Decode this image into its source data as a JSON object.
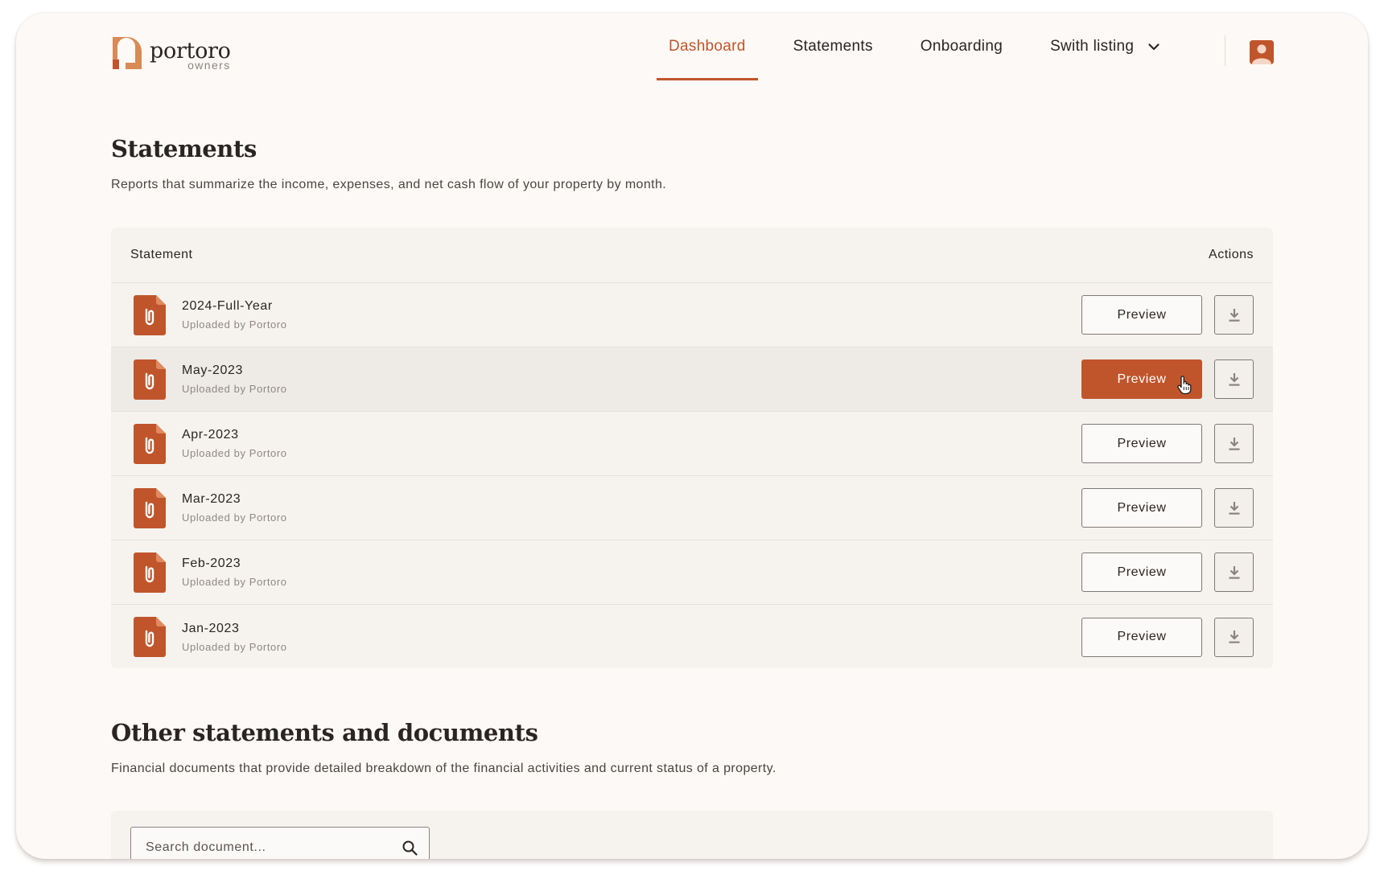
{
  "brand": {
    "name": "portoro",
    "sub": "owners",
    "accent": "#c0552b"
  },
  "nav": {
    "items": [
      {
        "label": "Dashboard",
        "active": true
      },
      {
        "label": "Statements",
        "active": false
      },
      {
        "label": "Onboarding",
        "active": false
      },
      {
        "label": "Swith listing",
        "active": false
      }
    ],
    "dropdown_icon": "chevron-down-icon",
    "avatar_icon": "user-avatar-icon"
  },
  "statements": {
    "title": "Statements",
    "description": "Reports that summarize the income, expenses, and net cash flow of your property by month.",
    "col_statement": "Statement",
    "col_actions": "Actions",
    "preview_label": "Preview",
    "rows": [
      {
        "name": "2024-Full-Year",
        "uploaded": "Uploaded by Portoro"
      },
      {
        "name": "May-2023",
        "uploaded": "Uploaded by Portoro"
      },
      {
        "name": "Apr-2023",
        "uploaded": "Uploaded by Portoro"
      },
      {
        "name": "Mar-2023",
        "uploaded": "Uploaded by Portoro"
      },
      {
        "name": "Feb-2023",
        "uploaded": "Uploaded by Portoro"
      },
      {
        "name": "Jan-2023",
        "uploaded": "Uploaded by Portoro"
      }
    ]
  },
  "documents": {
    "title": "Other statements and documents",
    "description": "Financial documents that provide detailed breakdown of the financial activities and current status of a property.",
    "search_placeholder": "Search document..."
  }
}
